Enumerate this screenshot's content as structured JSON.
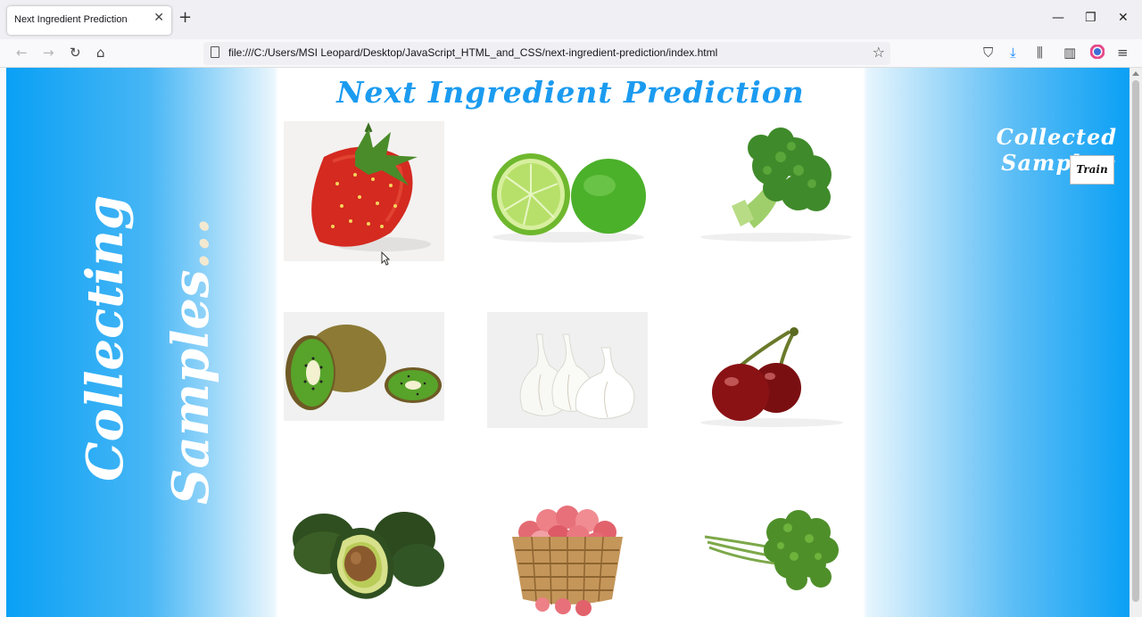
{
  "browser": {
    "tab_title": "Next Ingredient Prediction",
    "url": "file:///C:/Users/MSI Leopard/Desktop/JavaScript_HTML_and_CSS/next-ingredient-prediction/index.html"
  },
  "page": {
    "title": "Next Ingredient Prediction",
    "side_text_line1": "Collecting",
    "side_text_line2": "Samples",
    "side_text_ellipsis": "...",
    "collected_label": "Collected Samples:",
    "train_button": "Train"
  },
  "ingredients": [
    {
      "name": "strawberry"
    },
    {
      "name": "lime"
    },
    {
      "name": "broccoli"
    },
    {
      "name": "kiwi"
    },
    {
      "name": "garlic"
    },
    {
      "name": "cherry"
    },
    {
      "name": "avocado"
    },
    {
      "name": "apples"
    },
    {
      "name": "parsley"
    }
  ],
  "colors": {
    "accent_blue": "#0aa0f5",
    "title_blue": "#1b9bf0",
    "white": "#ffffff"
  }
}
